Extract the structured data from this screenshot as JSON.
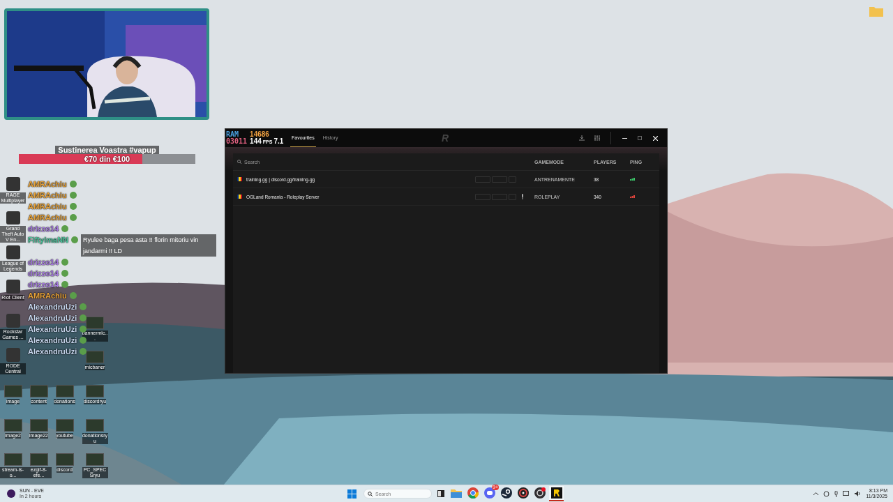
{
  "donation_goal": {
    "title": "Sustinerea Voastra #vapup",
    "amount": "€70 din €100",
    "level": 0.7
  },
  "chat": [
    {
      "name": "AMRAchiu",
      "color": "#e8a33a"
    },
    {
      "name": "AMRAchiu",
      "color": "#e8a33a"
    },
    {
      "name": "AMRAchiu",
      "color": "#e8a33a"
    },
    {
      "name": "AMRAchiu",
      "color": "#e8a33a"
    },
    {
      "name": "drizzo14",
      "color": "#a77be0"
    },
    {
      "name": "FiftyimaNN",
      "color": "#4fc9a0",
      "message": "Ryulee baga pesa asta !! florin mitoriu vin jandarmi !! LD"
    },
    {
      "name": "drizzo14",
      "color": "#a77be0"
    },
    {
      "name": "drizzo14",
      "color": "#a77be0"
    },
    {
      "name": "drizzo14",
      "color": "#a77be0"
    },
    {
      "name": "AMRAchiu",
      "color": "#e8a33a"
    },
    {
      "name": "AlexandruUzi",
      "color": "#c9d8f0"
    },
    {
      "name": "AlexandruUzi",
      "color": "#c9d8f0"
    },
    {
      "name": "AlexandruUzi",
      "color": "#c9d8f0"
    },
    {
      "name": "AlexandruUzi",
      "color": "#c9d8f0"
    },
    {
      "name": "AlexandruUzi",
      "color": "#c9d8f0"
    }
  ],
  "desktop_rows": [
    [
      {
        "kind": "app",
        "label": "RAGE Multiplayer"
      },
      {
        "kind": "empty"
      },
      {
        "kind": "empty"
      },
      {
        "kind": "empty"
      }
    ],
    [
      {
        "kind": "app",
        "label": "Grand Theft Auto V En..."
      },
      {
        "kind": "empty"
      },
      {
        "kind": "empty"
      },
      {
        "kind": "empty"
      }
    ],
    [
      {
        "kind": "app",
        "label": "League of Legends"
      },
      {
        "kind": "empty"
      },
      {
        "kind": "empty"
      },
      {
        "kind": "empty"
      }
    ],
    [
      {
        "kind": "app",
        "label": "Riot Client"
      },
      {
        "kind": "empty"
      },
      {
        "kind": "empty"
      },
      {
        "kind": "empty"
      }
    ],
    [
      {
        "kind": "app",
        "label": "Rockstar Games ..."
      },
      {
        "kind": "empty"
      },
      {
        "kind": "empty"
      },
      {
        "kind": "file",
        "label": "bannermic..."
      }
    ],
    [
      {
        "kind": "app",
        "label": "RODE Central"
      },
      {
        "kind": "empty"
      },
      {
        "kind": "empty"
      },
      {
        "kind": "file",
        "label": "micbaner"
      }
    ],
    [
      {
        "kind": "file",
        "label": "image"
      },
      {
        "kind": "file",
        "label": "content"
      },
      {
        "kind": "file",
        "label": "donations"
      },
      {
        "kind": "file",
        "label": "discordryu"
      }
    ],
    [
      {
        "kind": "file",
        "label": "image2"
      },
      {
        "kind": "file",
        "label": "image22"
      },
      {
        "kind": "file",
        "label": "youtube"
      },
      {
        "kind": "file",
        "label": "donationsryu"
      }
    ],
    [
      {
        "kind": "file",
        "label": "stream-is-o..."
      },
      {
        "kind": "file",
        "label": "ezgif-8-efe..."
      },
      {
        "kind": "file",
        "label": "discord"
      },
      {
        "kind": "file",
        "label": "PC_SPECSryu"
      }
    ]
  ],
  "app_window": {
    "osd": {
      "ram_label": "RAM",
      "ram_value": "14686",
      "second_value": "03011",
      "fps": "144",
      "fps_unit": "FPS",
      "frametime": "7.1"
    },
    "tabs": [
      {
        "label": "Favourites",
        "selected": true
      },
      {
        "label": "History",
        "selected": false
      }
    ],
    "logo": "R",
    "search": {
      "placeholder": "Search"
    },
    "columns": [
      "GAMEMODE",
      "PLAYERS",
      "PING"
    ],
    "servers": [
      {
        "name": "training.gg | discord.gg/training-gg",
        "voice": false,
        "gamemode": "ANTRENAMENTE",
        "players": "38",
        "color": "#3cc86a"
      },
      {
        "name": "OGLand Romania - Roleplay Server",
        "voice": true,
        "gamemode": "ROLEPLAY",
        "players": "340",
        "color": "#e0443c"
      }
    ]
  },
  "taskbar": {
    "weather": {
      "title": "SUN - EVE",
      "subtitle": "In 2 hours"
    },
    "search": {
      "placeholder": "Search"
    },
    "apps": [
      {
        "kind": "folder",
        "selected": false
      },
      {
        "kind": "browser",
        "selected": false
      },
      {
        "kind": "chat",
        "selected": false,
        "badge": "9+"
      },
      {
        "kind": "steam",
        "selected": false
      },
      {
        "kind": "target",
        "selected": false
      },
      {
        "kind": "recorder",
        "selected": false
      },
      {
        "kind": "r-app",
        "selected": true
      }
    ],
    "time": "8:13 PM",
    "date": "11/3/2025"
  }
}
